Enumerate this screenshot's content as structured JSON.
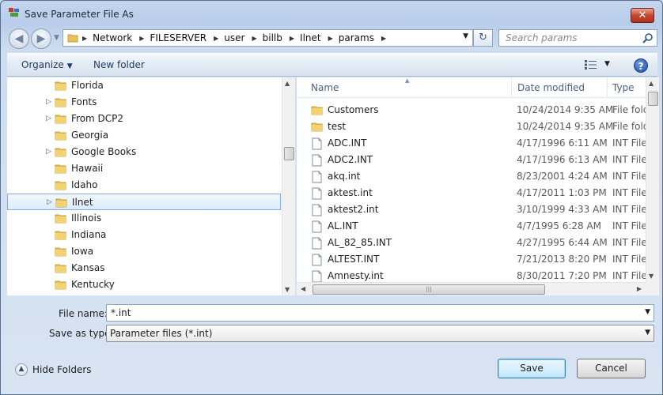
{
  "window": {
    "title": "Save Parameter File As",
    "close_label": "✕"
  },
  "address": {
    "crumbs": [
      "Network",
      "FILESERVER",
      "user",
      "billb",
      "Ilnet",
      "params"
    ],
    "search_placeholder": "Search params"
  },
  "toolbar": {
    "organize_label": "Organize",
    "new_folder_label": "New folder",
    "help_label": "?"
  },
  "nav": {
    "items": [
      {
        "label": "Florida",
        "expandable": false,
        "selected": false
      },
      {
        "label": "Fonts",
        "expandable": true,
        "selected": false
      },
      {
        "label": "From DCP2",
        "expandable": true,
        "selected": false
      },
      {
        "label": "Georgia",
        "expandable": false,
        "selected": false
      },
      {
        "label": "Google Books",
        "expandable": true,
        "selected": false
      },
      {
        "label": "Hawaii",
        "expandable": false,
        "selected": false
      },
      {
        "label": "Idaho",
        "expandable": false,
        "selected": false
      },
      {
        "label": "Ilnet",
        "expandable": true,
        "selected": true
      },
      {
        "label": "Illinois",
        "expandable": false,
        "selected": false
      },
      {
        "label": "Indiana",
        "expandable": false,
        "selected": false
      },
      {
        "label": "Iowa",
        "expandable": false,
        "selected": false
      },
      {
        "label": "Kansas",
        "expandable": false,
        "selected": false
      },
      {
        "label": "Kentucky",
        "expandable": false,
        "selected": false
      }
    ]
  },
  "files": {
    "columns": {
      "name": "Name",
      "date": "Date modified",
      "type": "Type"
    },
    "rows": [
      {
        "name": "Customers",
        "date": "10/24/2014 9:35 AM",
        "type": "File fold",
        "kind": "folder"
      },
      {
        "name": "test",
        "date": "10/24/2014 9:35 AM",
        "type": "File fold",
        "kind": "folder"
      },
      {
        "name": "ADC.INT",
        "date": "4/17/1996 6:11 AM",
        "type": "INT File",
        "kind": "file"
      },
      {
        "name": "ADC2.INT",
        "date": "4/17/1996 6:13 AM",
        "type": "INT File",
        "kind": "file"
      },
      {
        "name": "akq.int",
        "date": "8/23/2001 4:24 AM",
        "type": "INT File",
        "kind": "file"
      },
      {
        "name": "aktest.int",
        "date": "4/17/2011 1:03 PM",
        "type": "INT File",
        "kind": "file"
      },
      {
        "name": "aktest2.int",
        "date": "3/10/1999 4:33 AM",
        "type": "INT File",
        "kind": "file"
      },
      {
        "name": "AL.INT",
        "date": "4/7/1995 6:28 AM",
        "type": "INT File",
        "kind": "file"
      },
      {
        "name": "AL_82_85.INT",
        "date": "4/27/1995 6:44 AM",
        "type": "INT File",
        "kind": "file"
      },
      {
        "name": "ALTEST.INT",
        "date": "7/21/2013 8:20 PM",
        "type": "INT File",
        "kind": "file"
      },
      {
        "name": "Amnesty.int",
        "date": "8/30/2011 7:20 PM",
        "type": "INT File",
        "kind": "file"
      }
    ]
  },
  "form": {
    "file_name_label": "File name:",
    "file_name_value": "*.int",
    "save_type_label": "Save as type:",
    "save_type_value": "Parameter files (*.int)"
  },
  "footer": {
    "hide_folders_label": "Hide Folders",
    "save_label": "Save",
    "cancel_label": "Cancel"
  }
}
